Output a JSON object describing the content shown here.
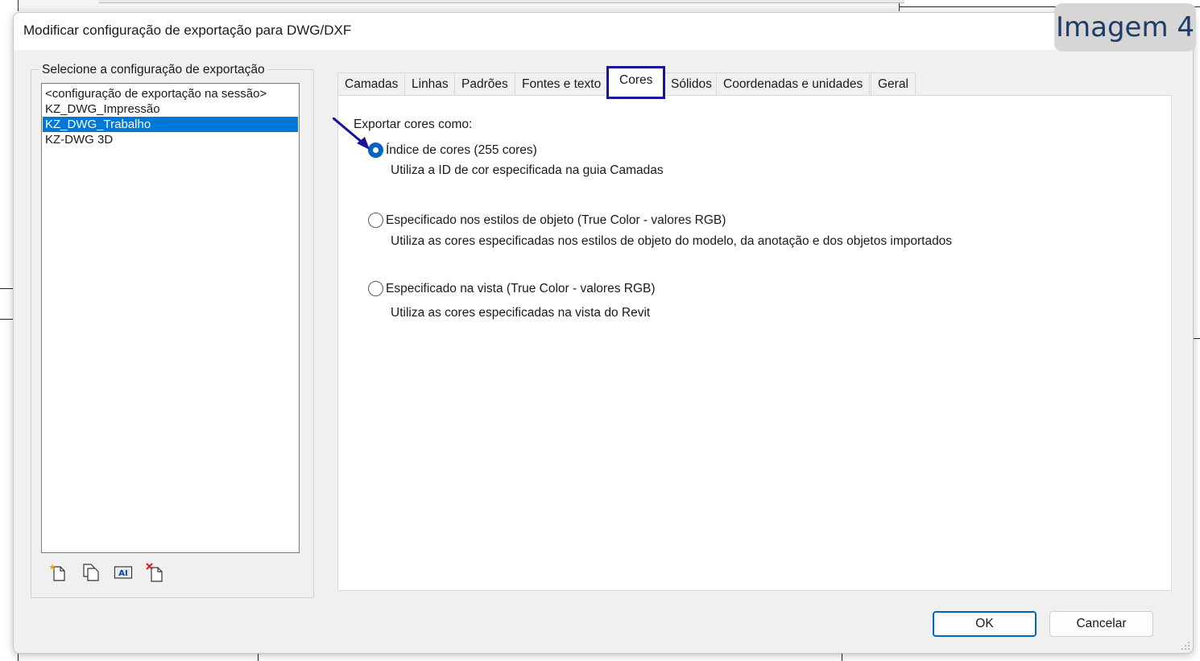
{
  "window": {
    "title": "Modificar configuração de exportação para DWG/DXF"
  },
  "badge": {
    "text": "Imagem 4"
  },
  "left_panel": {
    "label": "Selecione a configuração de exportação",
    "items": [
      {
        "label": "<configuração de exportação na sessão>",
        "selected": false
      },
      {
        "label": "KZ_DWG_Impressão",
        "selected": false
      },
      {
        "label": "KZ_DWG_Trabalho",
        "selected": true
      },
      {
        "label": "KZ-DWG 3D",
        "selected": false
      }
    ],
    "toolbar_icons": [
      "new-setup-icon",
      "duplicate-setup-icon",
      "rename-setup-icon",
      "delete-setup-icon"
    ]
  },
  "tabs": [
    {
      "label": "Camadas"
    },
    {
      "label": "Linhas"
    },
    {
      "label": "Padrões"
    },
    {
      "label": "Fontes e texto"
    },
    {
      "label": "Cores",
      "active": true
    },
    {
      "label": "Sólidos"
    },
    {
      "label": "Coordenadas e unidades"
    },
    {
      "label": "Geral"
    }
  ],
  "colors_tab": {
    "group_label": "Exportar cores como:",
    "options": [
      {
        "label": "Índice de cores (255 cores)",
        "description": "Utiliza a ID de cor especificada na guia Camadas",
        "checked": true
      },
      {
        "label": "Especificado nos estilos de objeto (True Color - valores RGB)",
        "description": "Utiliza as cores especificadas nos estilos de objeto do modelo, da anotação e dos objetos importados",
        "checked": false
      },
      {
        "label": "Especificado na vista (True Color - valores RGB)",
        "description": "Utiliza as cores especificadas na vista do Revit",
        "checked": false
      }
    ]
  },
  "buttons": {
    "ok": "OK",
    "cancel": "Cancelar"
  },
  "colors": {
    "accent": "#0067c0",
    "selection": "#0078d7",
    "highlight_box": "#16149c"
  }
}
